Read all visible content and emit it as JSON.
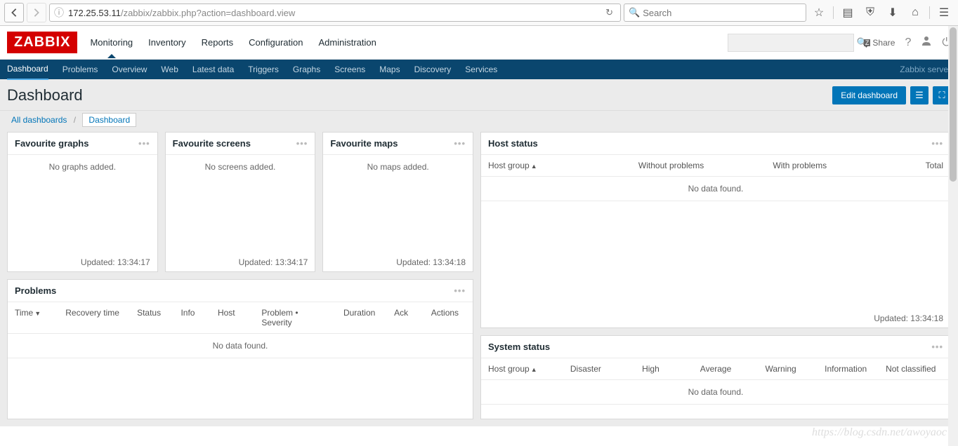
{
  "browser": {
    "url_host": "172.25.53.11",
    "url_path": "/zabbix/zabbix.php?action=dashboard.view",
    "search_placeholder": "Search"
  },
  "header": {
    "logo": "ZABBIX",
    "menu": [
      "Monitoring",
      "Inventory",
      "Reports",
      "Configuration",
      "Administration"
    ],
    "active_menu": "Monitoring",
    "share": "Share"
  },
  "subnav": {
    "items": [
      "Dashboard",
      "Problems",
      "Overview",
      "Web",
      "Latest data",
      "Triggers",
      "Graphs",
      "Screens",
      "Maps",
      "Discovery",
      "Services"
    ],
    "active": "Dashboard",
    "server": "Zabbix server"
  },
  "page": {
    "title": "Dashboard",
    "edit_btn": "Edit dashboard"
  },
  "breadcrumb": {
    "root": "All dashboards",
    "current": "Dashboard"
  },
  "widgets": {
    "fav_graphs": {
      "title": "Favourite graphs",
      "empty": "No graphs added.",
      "updated": "Updated: 13:34:17"
    },
    "fav_screens": {
      "title": "Favourite screens",
      "empty": "No screens added.",
      "updated": "Updated: 13:34:17"
    },
    "fav_maps": {
      "title": "Favourite maps",
      "empty": "No maps added.",
      "updated": "Updated: 13:34:18"
    },
    "problems": {
      "title": "Problems",
      "cols": [
        "Time",
        "Recovery time",
        "Status",
        "Info",
        "Host",
        "Problem • Severity",
        "Duration",
        "Ack",
        "Actions"
      ],
      "nodata": "No data found."
    },
    "host_status": {
      "title": "Host status",
      "cols": [
        "Host group",
        "Without problems",
        "With problems",
        "Total"
      ],
      "nodata": "No data found.",
      "updated": "Updated: 13:34:18"
    },
    "system_status": {
      "title": "System status",
      "cols": [
        "Host group",
        "Disaster",
        "High",
        "Average",
        "Warning",
        "Information",
        "Not classified"
      ],
      "nodata": "No data found."
    }
  },
  "watermark": "https://blog.csdn.net/awoyaoc"
}
